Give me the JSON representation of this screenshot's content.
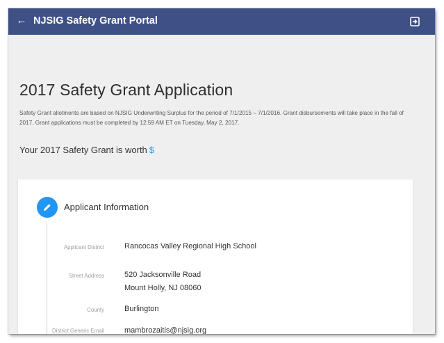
{
  "header": {
    "back_glyph": "←",
    "title": "NJSIG Safety Grant Portal",
    "icons": [
      "back-arrow-icon",
      "logout-icon"
    ],
    "color": "#3f5086"
  },
  "page": {
    "title": "2017 Safety Grant Application",
    "intro": "Safety Grant allotments are based on NJSIG Underwriting Surplus for the period of 7/1/2015 – 7/1/2016. Grant disbursements will take place in the fall of 2017. Grant applications must be completed by 12:59 AM ET on Tuesday, May 2, 2017.",
    "grant_text": "Your 2017 Safety Grant is worth",
    "grant_amount": "$",
    "accent_color": "#2196f3"
  },
  "applicant": {
    "section_title": "Applicant Information",
    "section_icon": "pencil-icon",
    "fields": [
      {
        "label": "Applicant District",
        "lines": [
          "Rancocas Valley Regional High School"
        ]
      },
      {
        "label": "Street Address",
        "lines": [
          "520 Jacksonville Road",
          "Mount Holly, NJ 08060"
        ]
      },
      {
        "label": "County",
        "lines": [
          "Burlington"
        ]
      },
      {
        "label": "District Generic Email",
        "lines": [
          "mambrozaitis@njsig.org"
        ]
      }
    ]
  }
}
